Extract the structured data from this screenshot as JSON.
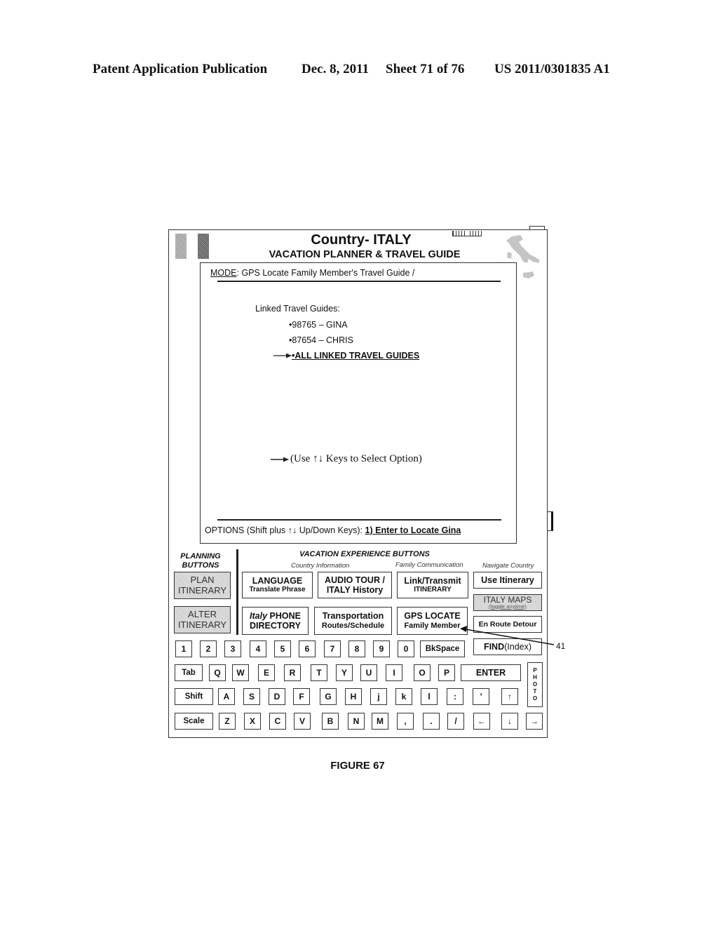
{
  "publication_header": {
    "left": "Patent Application Publication",
    "date": "Dec. 8, 2011",
    "sheet": "Sheet 71 of 76",
    "number": "US 2011/0301835 A1"
  },
  "device": {
    "title": "Country- ITALY",
    "subtitle": "VACATION PLANNER & TRAVEL GUIDE",
    "icons": [
      "italy-flag-icon",
      "battery-icon",
      "italy-map-icon"
    ]
  },
  "screen": {
    "mode_label": "MODE",
    "mode_text": ": GPS Locate Family Member's Travel Guide /",
    "guides_title": "Linked Travel Guides:",
    "guides": [
      "•98765 – GINA",
      "•87654 – CHRIS"
    ],
    "all_guides": "•ALL LINKED TRAVEL GUIDES",
    "hint": "(Use ↑↓ Keys to Select Option)",
    "options_prefix": "OPTIONS (Shift plus ↑↓ Up/Down Keys): ",
    "options_choice": "1) Enter to Locate Gina"
  },
  "planning": {
    "title": "PLANNING BUTTONS",
    "buttons": [
      {
        "line1": "PLAN",
        "line2": "ITINERARY"
      },
      {
        "line1": "ALTER",
        "line2": "ITINERARY"
      }
    ]
  },
  "vacation": {
    "title": "VACATION EXPERIENCE BUTTONS",
    "groups": {
      "country": "Country Information",
      "family": "Family Communication",
      "navigate": "Navigate Country"
    },
    "buttons": {
      "language": {
        "line1": "LANGUAGE",
        "line2": "Translate Phrase"
      },
      "audio": {
        "line1": "AUDIO TOUR /",
        "line2": "ITALY History"
      },
      "link": {
        "line1": "Link/Transmit",
        "line2": "ITINERARY"
      },
      "use_itinerary": {
        "line1": "Use Itinerary"
      },
      "phone": {
        "italic": "Italy",
        "line1": " PHONE",
        "line2": "DIRECTORY"
      },
      "transport": {
        "line1": "Transportation",
        "line2": "Routes/Schedule"
      },
      "gps": {
        "line1": "GPS LOCATE",
        "line2": "Family Member"
      },
      "maps": {
        "line1": "ITALY MAPS",
        "line2": "(toggle anytime)"
      },
      "detour": {
        "line1": "En Route Detour"
      },
      "find": {
        "bold": "FIND",
        "rest": " (Index)"
      }
    }
  },
  "keyboard": {
    "row1": [
      "1",
      "2",
      "3",
      "4",
      "5",
      "6",
      "7",
      "8",
      "9",
      "0",
      "BkSpace"
    ],
    "row2": [
      "Tab",
      "Q",
      "W",
      "E",
      "R",
      "T",
      "Y",
      "U",
      "I",
      "O",
      "P",
      "ENTER"
    ],
    "row3": [
      "Shift",
      "A",
      "S",
      "D",
      "F",
      "G",
      "H",
      "j",
      "k",
      "l",
      ":",
      "’",
      "↑"
    ],
    "row4": [
      "Scale",
      "Z",
      "X",
      "C",
      "V",
      "B",
      "N",
      "M",
      ",",
      ".",
      "/",
      "←",
      "↓",
      "→"
    ],
    "photo": [
      "P",
      "H",
      "O",
      "T",
      "O"
    ]
  },
  "callout": "41",
  "figure_caption": "FIGURE 67"
}
